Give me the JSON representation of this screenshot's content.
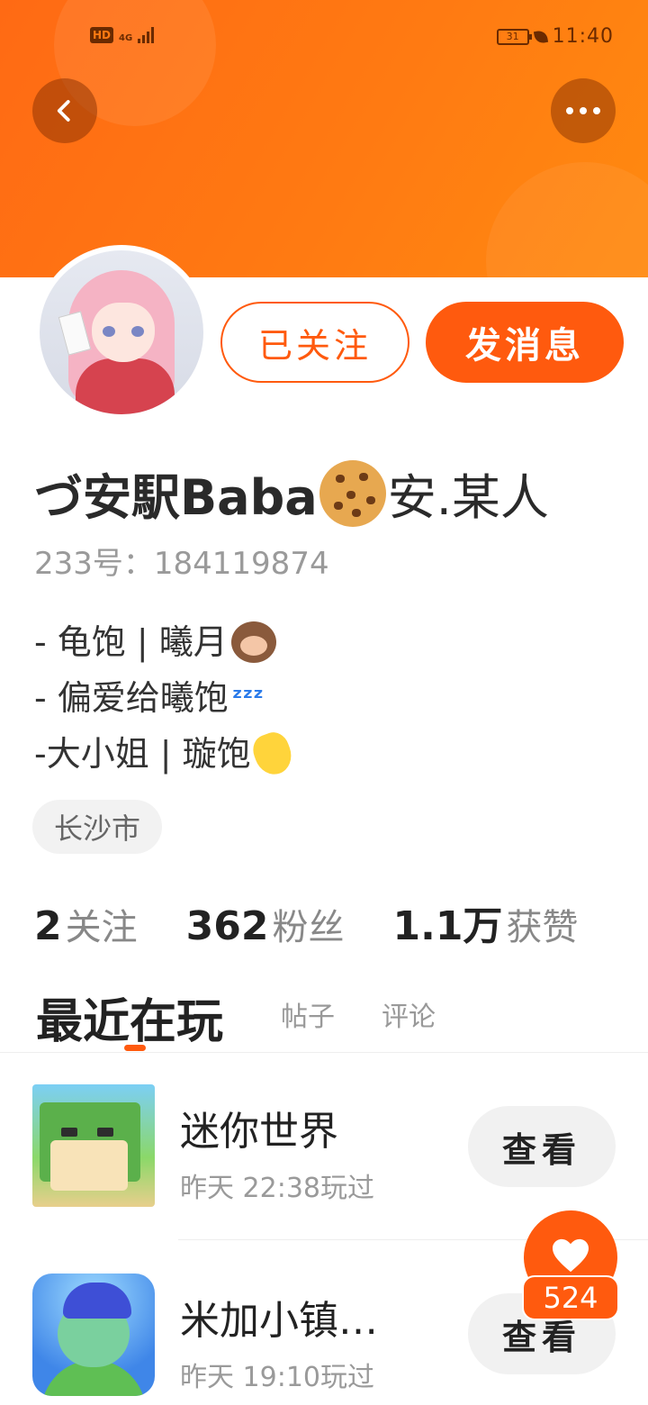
{
  "statusbar": {
    "hd": "HD",
    "network": "4G",
    "battery": "31",
    "time": "11:40"
  },
  "header": {
    "back_icon": "chevron-left-icon",
    "more_icon": "more-horizontal-icon"
  },
  "actions": {
    "follow_label": "已关注",
    "message_label": "发消息"
  },
  "profile": {
    "name_part1": "づ安駅Baba",
    "name_emoji": "cookie-emoji",
    "name_part2": "安.某人",
    "uid": "233号：184119874",
    "bio": [
      {
        "text": "- 龟饱 | 曦月",
        "emoji": "see-no-evil-monkey-emoji"
      },
      {
        "text": "- 偏爱给曦饱",
        "emoji": "zzz-emoji"
      },
      {
        "text": "-大小姐 | 璇饱",
        "emoji": "waving-hand-emoji"
      }
    ],
    "location": "长沙市"
  },
  "stats": [
    {
      "num": "2",
      "label": "关注"
    },
    {
      "num": "362",
      "label": "粉丝"
    },
    {
      "num": "1.1万",
      "label": "获赞"
    }
  ],
  "tabs": [
    {
      "label": "最近在玩",
      "active": true
    },
    {
      "label": "帖子",
      "active": false
    },
    {
      "label": "评论",
      "active": false
    }
  ],
  "games": [
    {
      "title": "迷你世界",
      "time": "昨天 22:38玩过",
      "button": "查看"
    },
    {
      "title": "米加小镇…",
      "time": "昨天 19:10玩过",
      "button": "查看"
    }
  ],
  "like": {
    "icon": "heart-icon",
    "count": "524"
  },
  "colors": {
    "accent": "#ff5a0e",
    "banner": "#ff7a12"
  }
}
